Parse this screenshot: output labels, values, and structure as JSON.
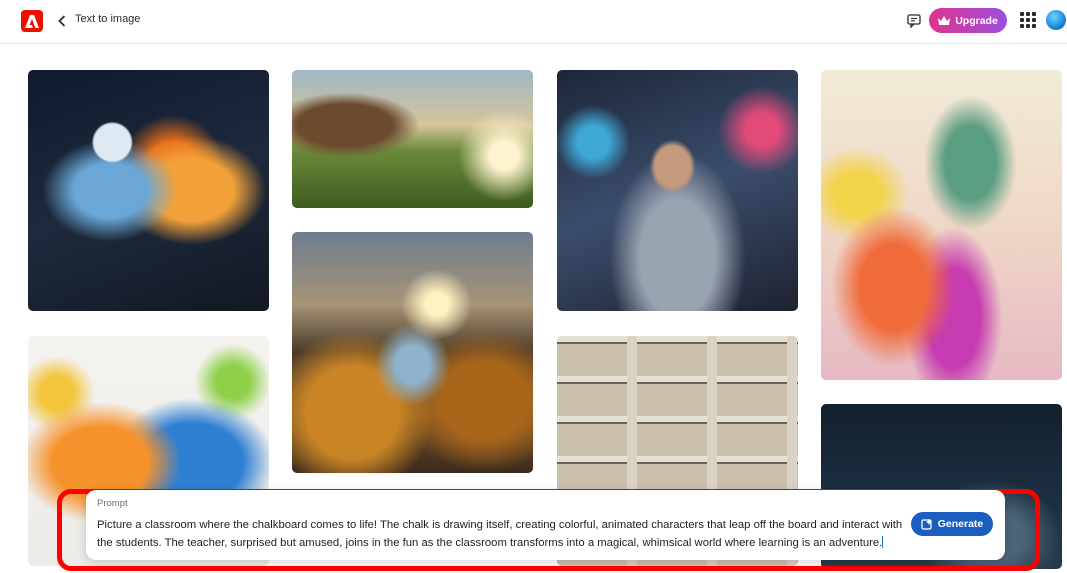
{
  "header": {
    "title": "Text to image",
    "upgrade_label": "Upgrade",
    "brand_color": "#eb1000"
  },
  "gallery": {
    "images": [
      {
        "name": "gallery-image-phoenix-birds"
      },
      {
        "name": "gallery-image-cabin-meadow"
      },
      {
        "name": "gallery-image-woman-city"
      },
      {
        "name": "gallery-image-hummingbird"
      },
      {
        "name": "gallery-image-sunset-landscape"
      },
      {
        "name": "gallery-image-colorful-cats"
      },
      {
        "name": "gallery-image-bookshelf"
      },
      {
        "name": "gallery-image-dark-sea"
      }
    ]
  },
  "prompt": {
    "label": "Prompt",
    "text": "Picture a classroom where the chalkboard comes to life! The chalk is drawing itself, creating colorful, animated characters that leap off the board and interact with the students. The teacher, surprised but amused, joins in the fun as the classroom transforms into a magical, whimsical world where learning is an adventure.",
    "generate_label": "Generate",
    "highlight_color": "#ff0000"
  }
}
